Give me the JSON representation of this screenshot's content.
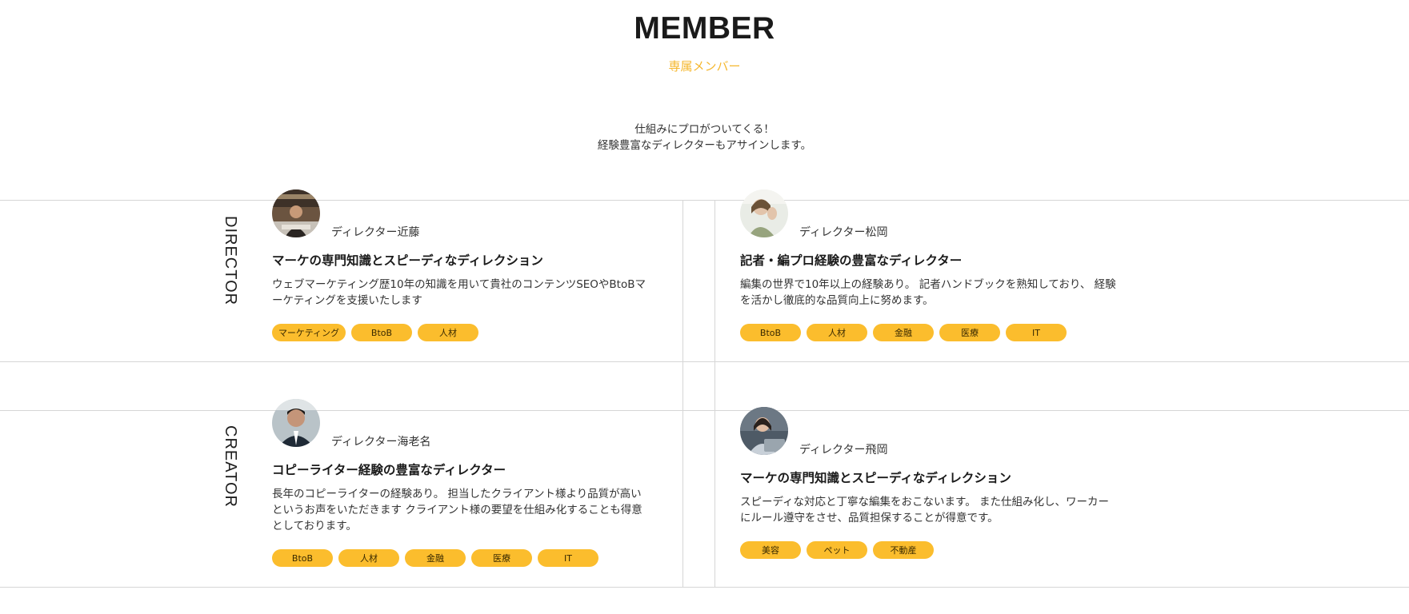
{
  "hero": {
    "title": "MEMBER",
    "subtitle": "専属メンバー",
    "desc_line1": "仕組みにプロがついてくる！",
    "desc_line2": "経験豊富なディレクターもアサインします。"
  },
  "sections": {
    "director_label": "DIRECTOR",
    "creator_label": "CREATOR"
  },
  "members": [
    {
      "name": "ディレクター近藤",
      "title": "マーケの専門知識とスピーディなディレクション",
      "desc_line1": "ウェブマーケティング歴10年の知識を用いて貴社のコンテンツSEOやBtoBマ",
      "desc_line2": "ーケティングを支援いたします",
      "tags": [
        "マーケティング",
        "BtoB",
        "人材"
      ]
    },
    {
      "name": "ディレクター松岡",
      "title": "記者・編プロ経験の豊富なディレクター",
      "desc_line1": "編集の世界で10年以上の経験あり。 記者ハンドブックを熟知しており、 経験",
      "desc_line2": "を活かし徹底的な品質向上に努めます。",
      "tags": [
        "BtoB",
        "人材",
        "金融",
        "医療",
        "IT"
      ]
    },
    {
      "name": "ディレクター海老名",
      "title": "コピーライター経験の豊富なディレクター",
      "desc_line1": "長年のコピーライターの経験あり。 担当したクライアント様より品質が高い",
      "desc_line2": "というお声をいただきます クライアント様の要望を仕組み化することも得意",
      "desc_line3": "としております。",
      "tags": [
        "BtoB",
        "人材",
        "金融",
        "医療",
        "IT"
      ]
    },
    {
      "name": "ディレクター飛岡",
      "title": "マーケの専門知識とスピーディなディレクション",
      "desc_line1": "スピーディな対応と丁寧な編集をおこないます。 また仕組み化し、ワーカー",
      "desc_line2": "にルール遵守をさせ、品質担保することが得意です。",
      "tags": [
        "美容",
        "ペット",
        "不動産"
      ]
    }
  ],
  "colors": {
    "accent": "#fbbd2d",
    "subtitle": "#f5b72e",
    "divider": "#d6d6d6"
  }
}
